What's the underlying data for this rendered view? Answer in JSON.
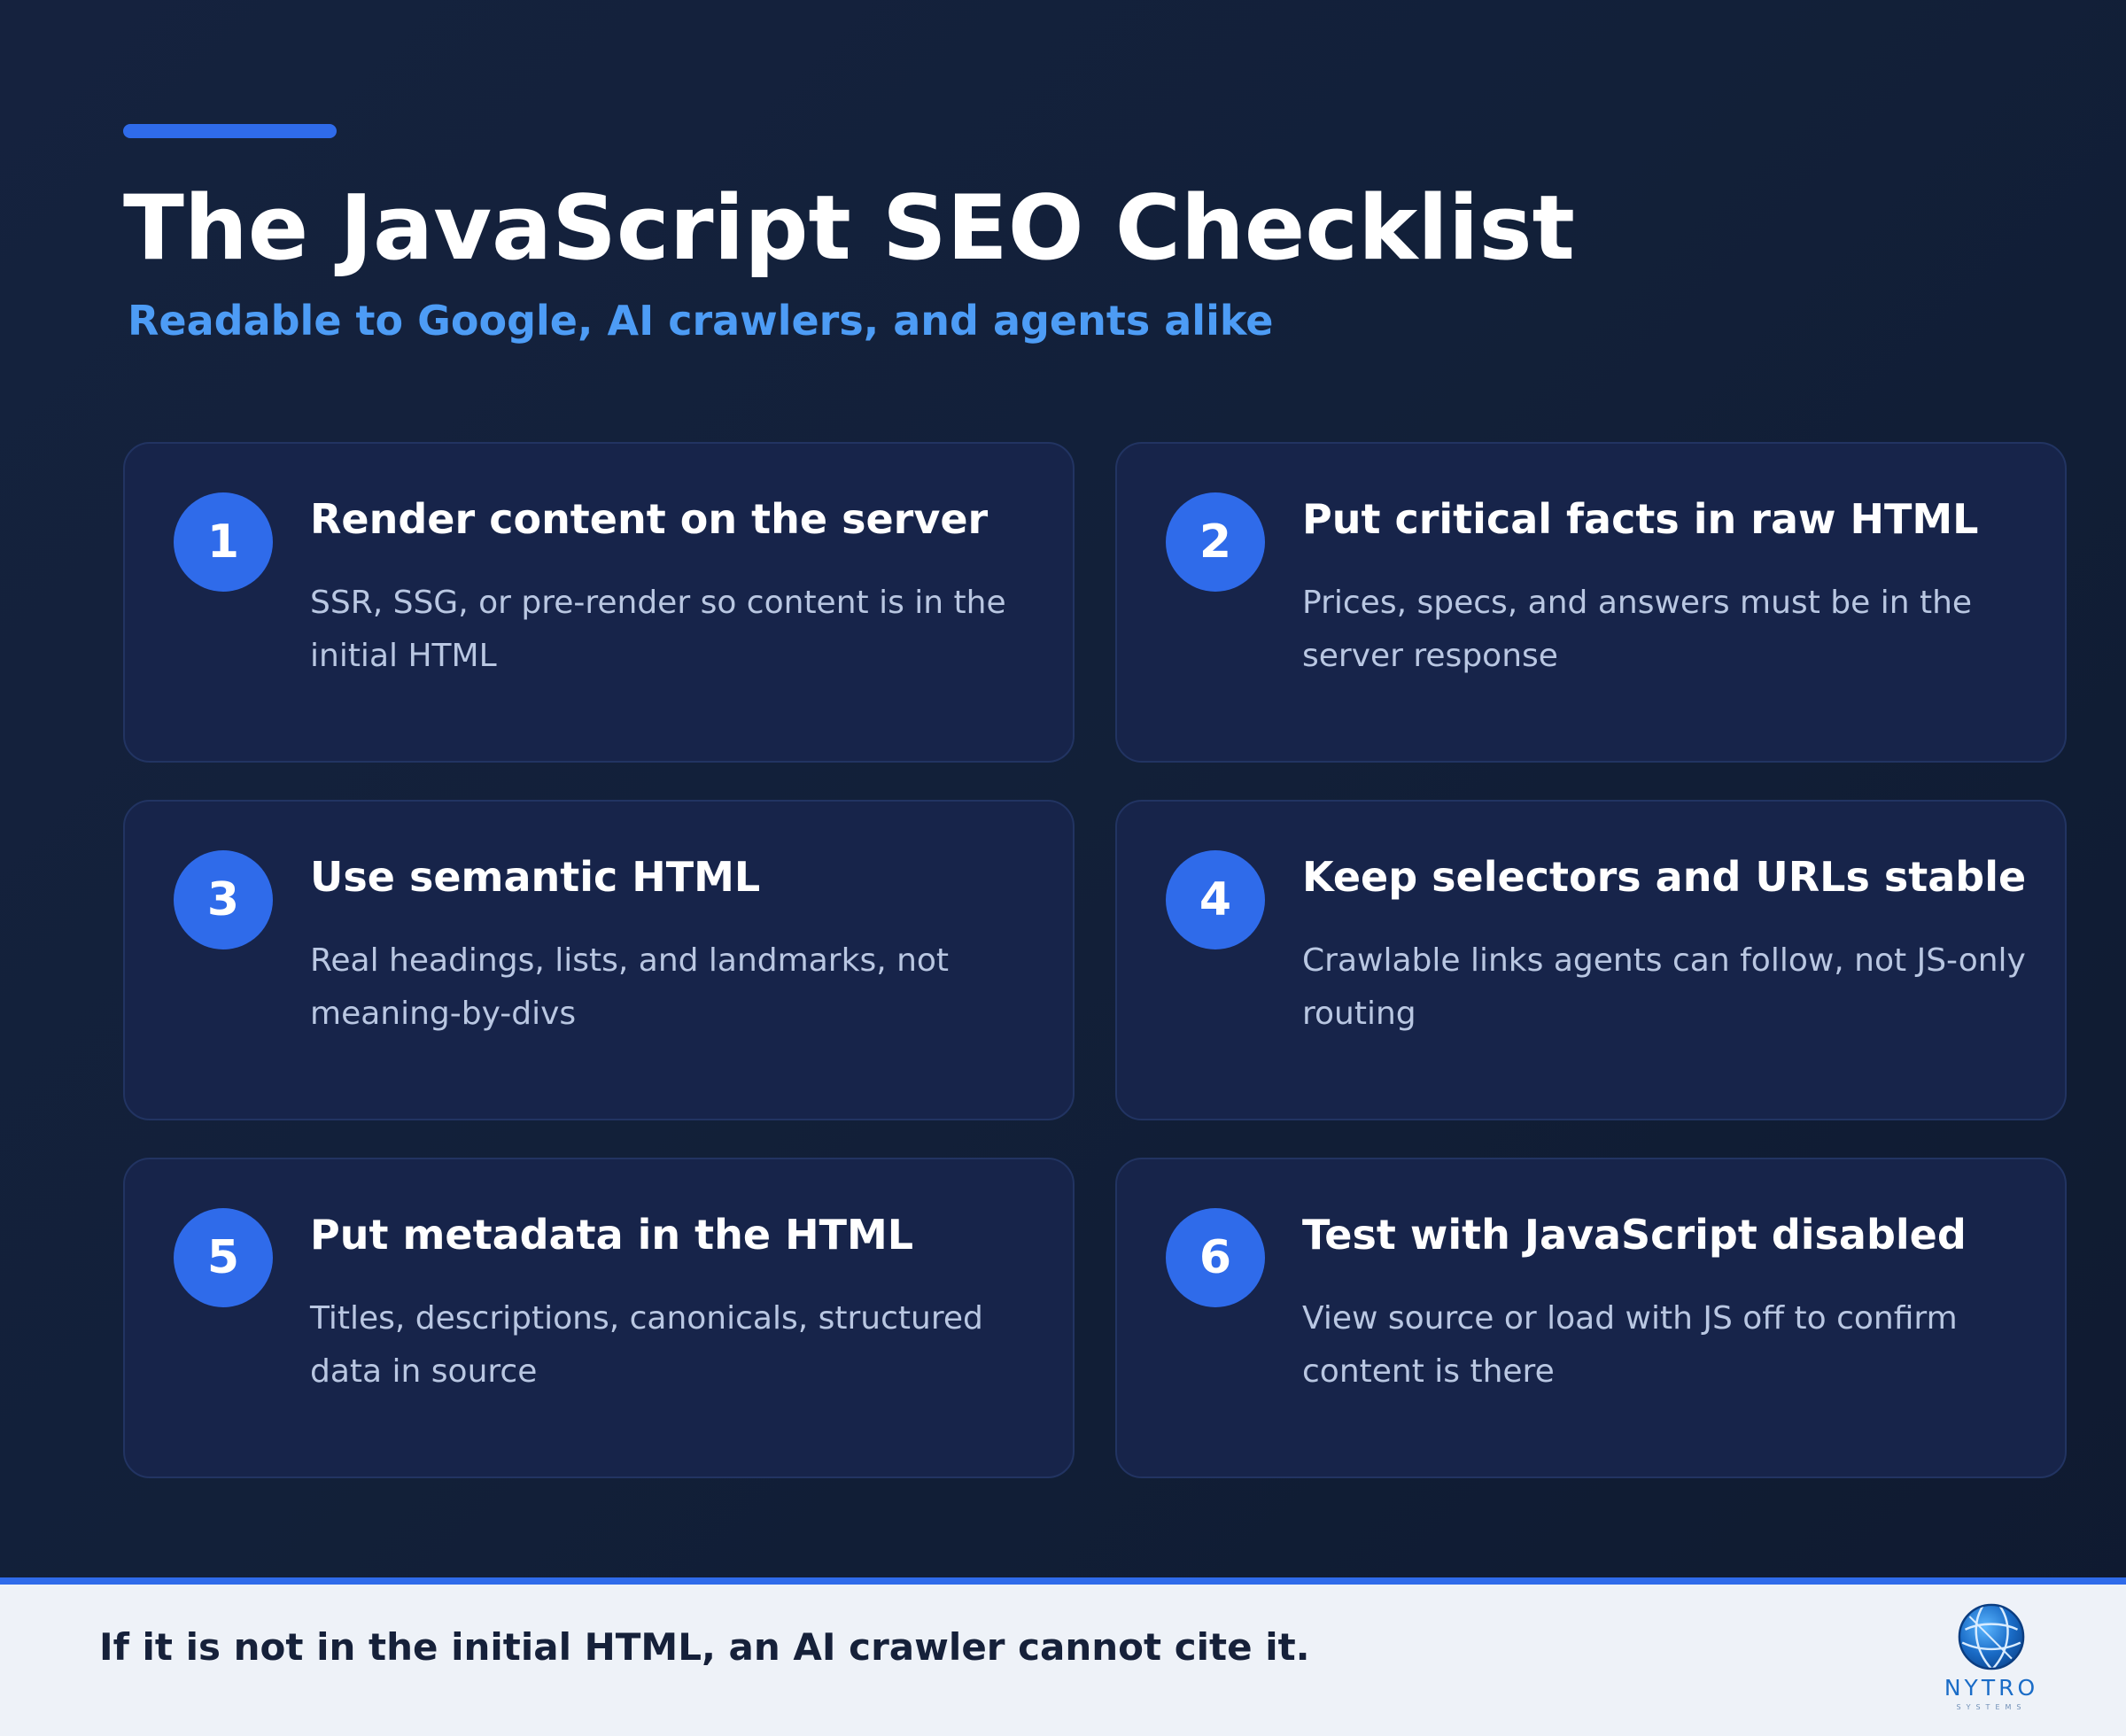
{
  "header": {
    "title": "The JavaScript SEO Checklist",
    "subtitle": "Readable to Google, AI crawlers, and agents alike"
  },
  "items": [
    {
      "number": "1",
      "title": "Render content on the server",
      "description": "SSR, SSG, or pre-render so content is in the initial HTML"
    },
    {
      "number": "2",
      "title": "Put critical facts in raw HTML",
      "description": "Prices, specs, and answers must be in the server response"
    },
    {
      "number": "3",
      "title": "Use semantic HTML",
      "description": "Real headings, lists, and landmarks, not meaning-by-divs"
    },
    {
      "number": "4",
      "title": "Keep selectors and URLs stable",
      "description": "Crawlable links agents can follow, not JS-only routing"
    },
    {
      "number": "5",
      "title": "Put metadata in the HTML",
      "description": "Titles, descriptions, canonicals, structured data in source"
    },
    {
      "number": "6",
      "title": "Test with JavaScript disabled",
      "description": "View source or load with JS off to confirm content is there"
    }
  ],
  "footer": {
    "tagline": "If it is not in the initial HTML, an AI crawler cannot cite it.",
    "logo_name": "NYTRO",
    "logo_sub": "SYSTEMS"
  },
  "colors": {
    "background": "#122039",
    "card": "#17244a",
    "accent": "#2f6bea",
    "subtitle": "#4d9cf5",
    "footer": "#eef2f8"
  }
}
